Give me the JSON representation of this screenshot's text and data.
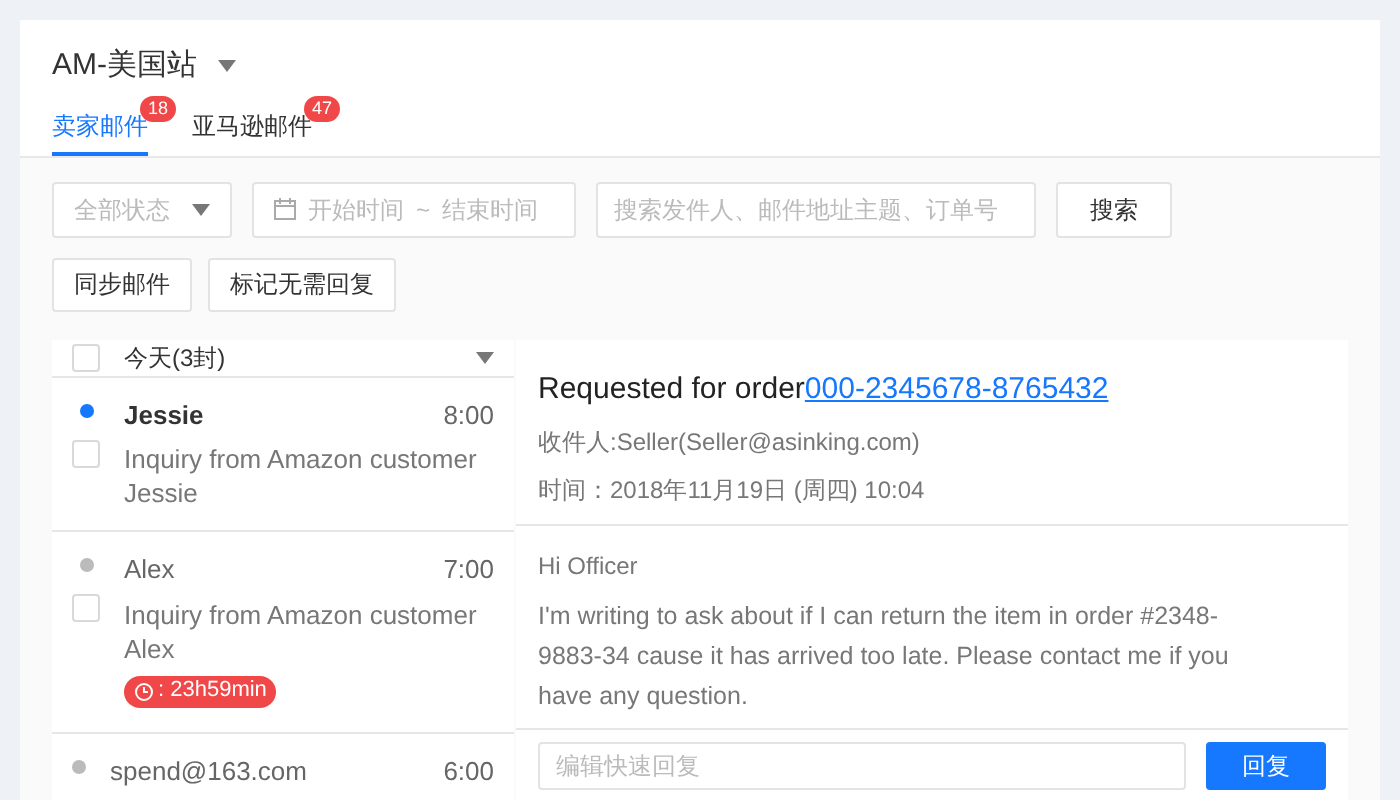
{
  "store_selector": {
    "label": "AM-美国站"
  },
  "tabs": [
    {
      "label": "卖家邮件",
      "badge": "18",
      "selected": true
    },
    {
      "label": "亚马逊邮件",
      "badge": "47",
      "selected": false
    }
  ],
  "filters": {
    "status": {
      "placeholder": "全部状态"
    },
    "start_date": {
      "placeholder": "开始时间"
    },
    "separator": "~",
    "end_date": {
      "placeholder": "结束时间"
    },
    "search": {
      "placeholder": "搜索发件人、邮件地址主题、订单号"
    },
    "search_button": "搜索"
  },
  "actions": [
    "同步邮件",
    "标记无需回复"
  ],
  "mail_list": {
    "group_label": "今天(3封)",
    "group_checked": false,
    "group_expanded": true,
    "items": [
      {
        "sender": "Jessie",
        "time": "8:00",
        "subject": "Inquiry from Amazon customer Jessie",
        "unread": true,
        "checked": false
      },
      {
        "sender": "Alex",
        "time": "7:00",
        "subject": "Inquiry from Amazon customer Alex",
        "unread": false,
        "checked": false,
        "timer": ": 23h59min"
      },
      {
        "sender": "spend@163.com",
        "time": "6:00",
        "unread": false
      }
    ]
  },
  "message": {
    "title": "Requested for order",
    "order_link": "000-2345678-8765432",
    "recipient": "收件人:Seller(Seller@asinking.com)",
    "time": "时间：2018年11月19日 (周四) 10:04",
    "greeting": "Hi Officer",
    "body": "I'm writing to ask about if I can return the item in order #2348-9883-34 cause it has arrived too late. Please contact me if you have any question."
  },
  "reply": {
    "placeholder": "编辑快速回复",
    "button": "回复"
  }
}
